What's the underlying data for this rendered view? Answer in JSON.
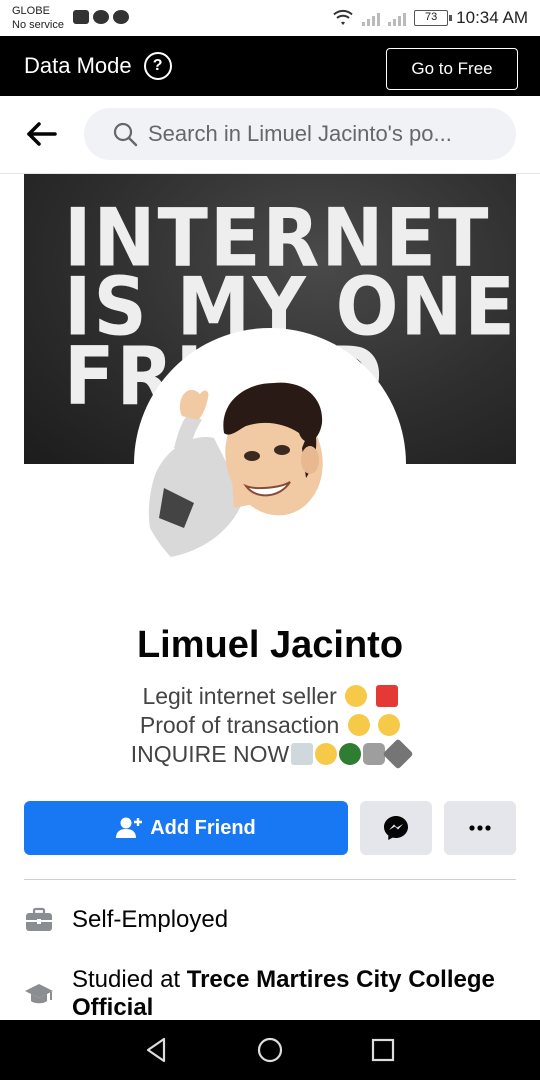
{
  "status_bar": {
    "carrier": "GLOBE",
    "service": "No service",
    "battery": "73",
    "time": "10:34 AM"
  },
  "data_mode_bar": {
    "title": "Data Mode",
    "help": "?",
    "go_free_label": "Go to Free"
  },
  "search": {
    "placeholder": "Search in Limuel Jacinto's po..."
  },
  "cover": {
    "text": "INTERNET\nIS MY ONE\nFRIEND"
  },
  "profile": {
    "name": "Limuel Jacinto",
    "bio": [
      "Legit internet seller",
      "Proof of transaction",
      "INQUIRE NOW"
    ]
  },
  "actions": {
    "add_friend_label": "Add Friend",
    "more_label": "..."
  },
  "details": {
    "work": "Self-Employed",
    "education_prefix": "Studied at ",
    "education_school": "Trece Martires City College Official"
  },
  "colors": {
    "primary": "#1877f2",
    "button_gray": "#e4e6eb",
    "search_bg": "#f0f2f5",
    "text_secondary": "#65676b"
  }
}
